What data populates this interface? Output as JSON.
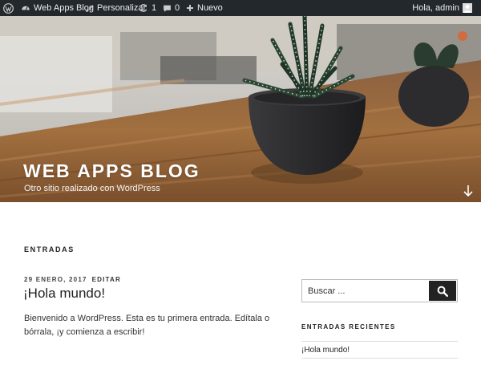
{
  "admin_bar": {
    "site_name": "Web Apps Blog",
    "customize_label": "Personalizar",
    "updates_count": "1",
    "comments_count": "0",
    "new_label": "Nuevo",
    "greeting": "Hola, admin"
  },
  "header": {
    "site_title": "WEB APPS BLOG",
    "description": "Otro sitio realizado con WordPress"
  },
  "main": {
    "section_title": "ENTRADAS",
    "post": {
      "date": "29 ENERO, 2017",
      "edit_label": "EDITAR",
      "title": "¡Hola mundo!",
      "excerpt": "Bienvenido a WordPress. Esta es tu primera entrada. Edítala o bórrala, ¡y comienza a escribir!"
    }
  },
  "sidebar": {
    "search_placeholder": "Buscar ...",
    "recent_title": "ENTRADAS RECIENTES",
    "recent_posts": [
      "¡Hola mundo!"
    ]
  },
  "colors": {
    "admin_bar_bg": "#23282d",
    "text_dark": "#222222",
    "search_button_bg": "#222222"
  },
  "icons": [
    "wordpress-logo-icon",
    "dashboard-icon",
    "brush-icon",
    "updates-icon",
    "comment-icon",
    "plus-icon",
    "avatar-icon",
    "arrow-down-icon",
    "search-icon"
  ]
}
